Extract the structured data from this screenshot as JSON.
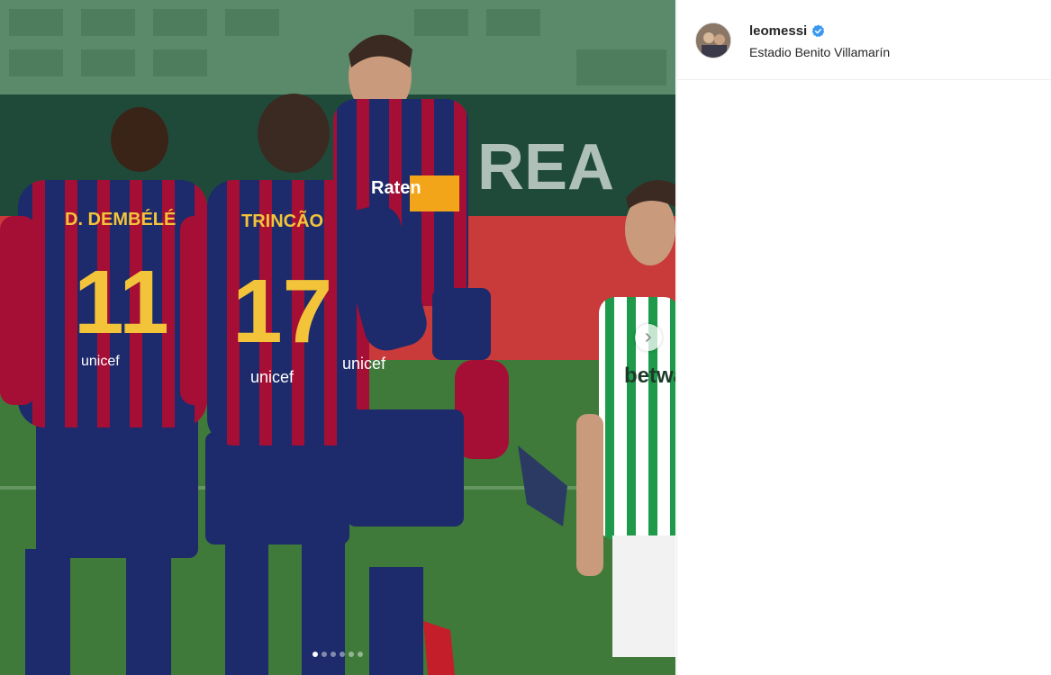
{
  "post": {
    "image": {
      "description_icon": "photo",
      "jerseys": [
        "D. DEMBÉLÉ",
        "11",
        "TRINCÃO",
        "17",
        "Rakuten",
        "unicef",
        "betway"
      ],
      "carousel": {
        "total": 6,
        "active_index": 0
      }
    }
  },
  "header": {
    "username": "leomessi",
    "location": "Estadio Benito Villamarín",
    "verified_icon": "verified-badge-icon"
  },
  "colors": {
    "verified": "#3897f0",
    "barca_blue": "#1d2a6b",
    "barca_red": "#a50f36",
    "betis_green": "#1e9a4a"
  }
}
